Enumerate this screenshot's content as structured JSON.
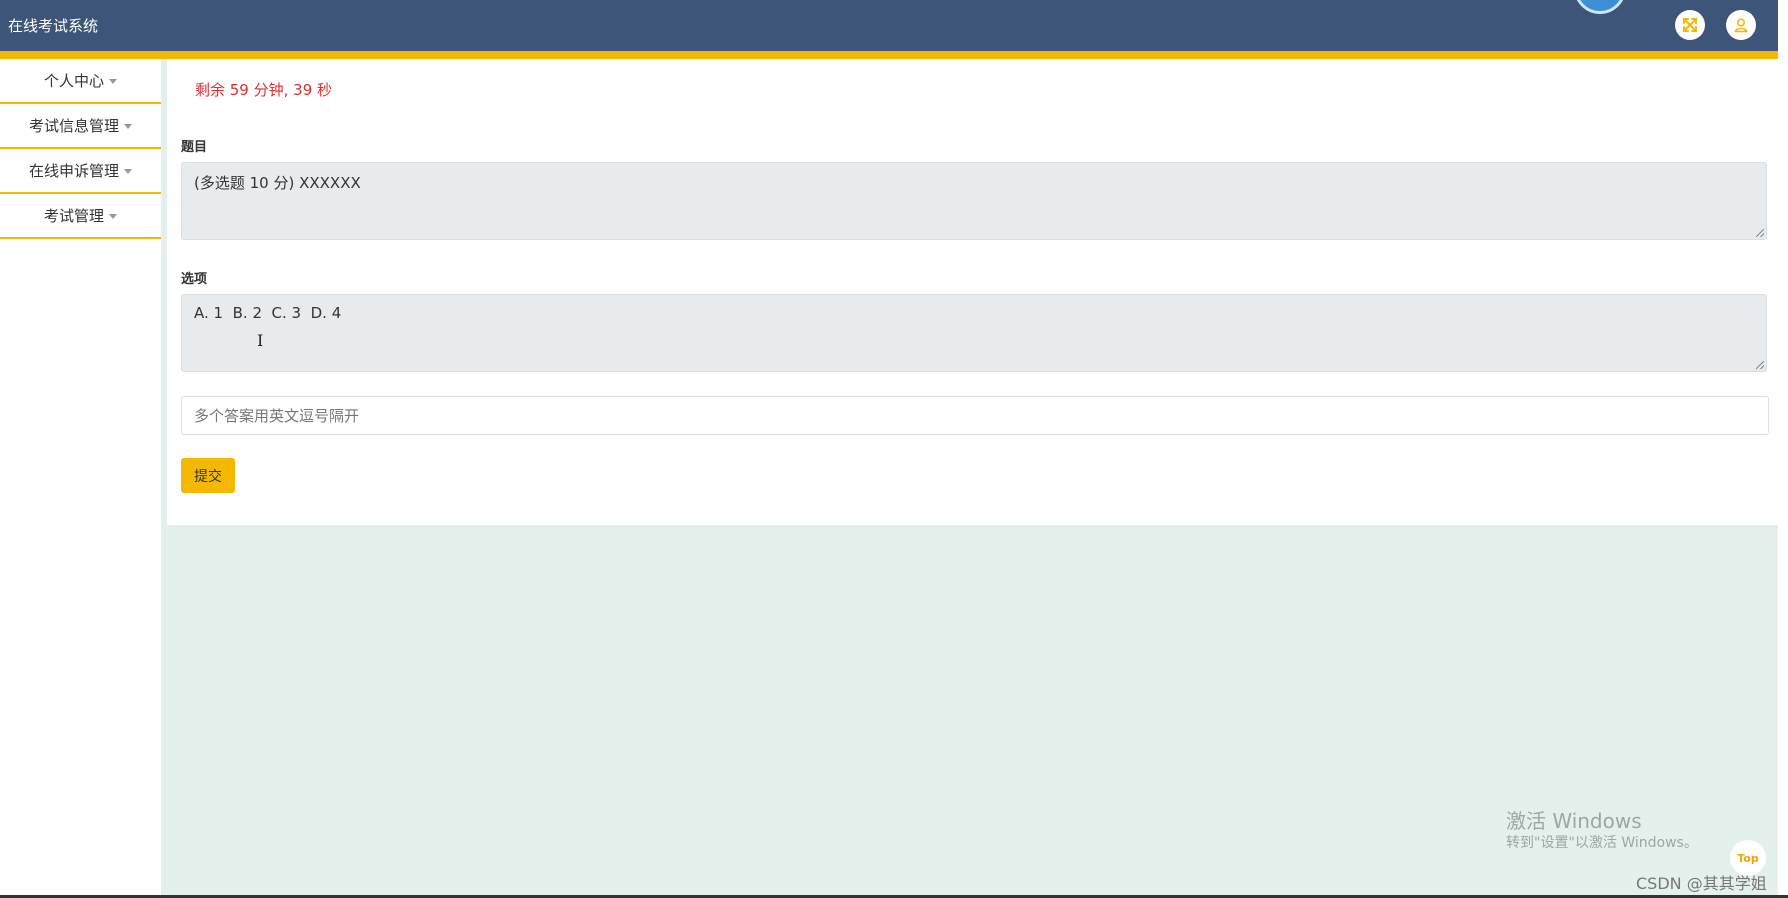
{
  "header": {
    "app_title": "在线考试系统",
    "fullscreen_icon": "fullscreen-icon",
    "user_icon": "user-icon",
    "accent_color": "#f5b800",
    "header_color": "#3d5579"
  },
  "sidebar": {
    "items": [
      {
        "label": "个人中心"
      },
      {
        "label": "考试信息管理"
      },
      {
        "label": "在线申诉管理"
      },
      {
        "label": "考试管理"
      }
    ]
  },
  "exam": {
    "timer_text": "剩余 59 分钟, 39 秒",
    "question_label": "题目",
    "question_text": "(多选题 10 分) XXXXXX",
    "options_label": "选项",
    "options_text": "A. 1  B. 2  C. 3  D. 4",
    "answer_placeholder": "多个答案用英文逗号隔开",
    "submit_label": "提交"
  },
  "overlay": {
    "windows_title": "激活 Windows",
    "windows_sub": "转到\"设置\"以激活 Windows。",
    "top_button": "Top",
    "csdn_watermark": "CSDN @其其学姐"
  }
}
